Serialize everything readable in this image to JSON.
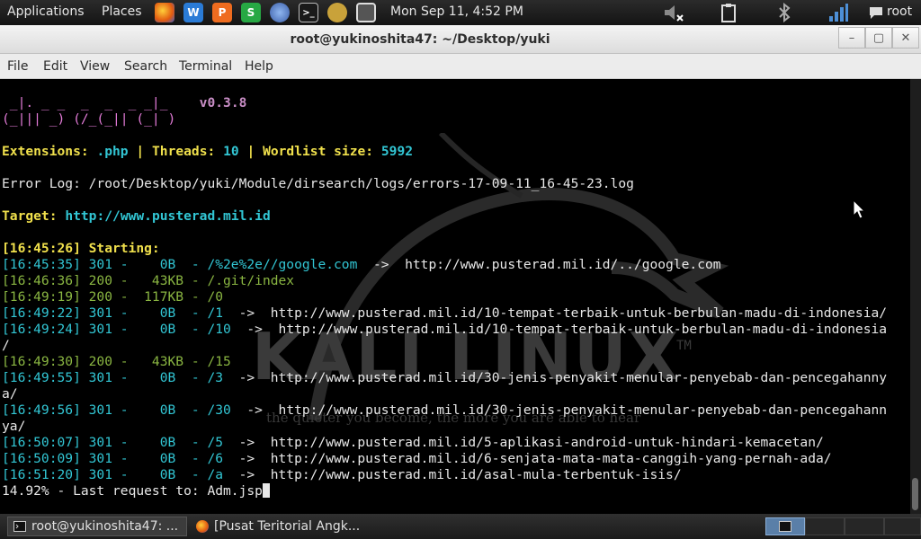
{
  "panel": {
    "applications": "Applications",
    "places": "Places",
    "clock": "Mon Sep 11,  4:52 PM",
    "user": "root",
    "launchers": [
      "firefox-icon",
      "writer-icon",
      "impress-icon",
      "calc-icon",
      "network-icon",
      "terminal-icon",
      "burp-icon",
      "screenshot-icon"
    ],
    "tray": [
      "volume-muted-icon",
      "clipboard-icon",
      "bluetooth-icon",
      "signal-icon",
      "chat-icon"
    ]
  },
  "window": {
    "title": "root@yukinoshita47: ~/Desktop/yuki",
    "controls": {
      "minimize": "–",
      "maximize": "▢",
      "close": "✕"
    }
  },
  "menu": [
    "File",
    "Edit",
    "View",
    "Search",
    "Terminal",
    "Help"
  ],
  "terminal": {
    "banner1": " _|. _ _  _  _  _ _|_",
    "banner2": "(_||| _) (/_(_|| (_| )",
    "version": "v0.3.8",
    "ext_label": "Extensions:",
    "ext_value": ".php",
    "threads_label": "Threads:",
    "threads_value": "10",
    "wordlist_label": "Wordlist size:",
    "wordlist_value": "5992",
    "sep": "|",
    "error_log": "Error Log: /root/Desktop/yuki/Module/dirsearch/logs/errors-17-09-11_16-45-23.log",
    "target_label": "Target:",
    "target_value": "http://www.pusterad.mil.id",
    "starting": "[16:45:26] Starting:",
    "rows": [
      {
        "meta": "[16:45:35] 301 -    0B  - /%2e%2e//google.com",
        "arrow": "  ->  ",
        "url": "http://www.pusterad.mil.id/../google.com",
        "color": "c"
      },
      {
        "meta": "[16:46:36] 200 -   43KB - /.git/index",
        "arrow": "",
        "url": "",
        "color": "g"
      },
      {
        "meta": "[16:49:19] 200 -  117KB - /0",
        "arrow": "",
        "url": "",
        "color": "g"
      },
      {
        "meta": "[16:49:22] 301 -    0B  - /1",
        "arrow": "  ->  ",
        "url": "http://www.pusterad.mil.id/10-tempat-terbaik-untuk-berbulan-madu-di-indonesia/",
        "color": "c"
      },
      {
        "meta": "[16:49:24] 301 -    0B  - /10",
        "arrow": "  ->  ",
        "url": "http://www.pusterad.mil.id/10-tempat-terbaik-untuk-berbulan-madu-di-indonesia",
        "color": "c"
      },
      {
        "meta": "/",
        "arrow": "",
        "url": "",
        "color": "w"
      },
      {
        "meta": "[16:49:30] 200 -   43KB - /15",
        "arrow": "",
        "url": "",
        "color": "g"
      },
      {
        "meta": "[16:49:55] 301 -    0B  - /3",
        "arrow": "  ->  ",
        "url": "http://www.pusterad.mil.id/30-jenis-penyakit-menular-penyebab-dan-pencegahanny",
        "color": "c"
      },
      {
        "meta": "a/",
        "arrow": "",
        "url": "",
        "color": "w"
      },
      {
        "meta": "[16:49:56] 301 -    0B  - /30",
        "arrow": "  ->  ",
        "url": "http://www.pusterad.mil.id/30-jenis-penyakit-menular-penyebab-dan-pencegahann",
        "color": "c"
      },
      {
        "meta": "ya/",
        "arrow": "",
        "url": "",
        "color": "w"
      },
      {
        "meta": "[16:50:07] 301 -    0B  - /5",
        "arrow": "  ->  ",
        "url": "http://www.pusterad.mil.id/5-aplikasi-android-untuk-hindari-kemacetan/",
        "color": "c"
      },
      {
        "meta": "[16:50:09] 301 -    0B  - /6",
        "arrow": "  ->  ",
        "url": "http://www.pusterad.mil.id/6-senjata-mata-mata-canggih-yang-pernah-ada/",
        "color": "c"
      },
      {
        "meta": "[16:51:20] 301 -    0B  - /a",
        "arrow": "  ->  ",
        "url": "http://www.pusterad.mil.id/asal-mula-terbentuk-isis/",
        "color": "c"
      }
    ],
    "progress": "14.92% - Last request to: Adm.jsp",
    "watermark": "KALI LINUX",
    "watermark_tm": "TM",
    "tagline": "the quieter you become, the more you are able to hear"
  },
  "taskbar": {
    "task1": "root@yukinoshita47: ...",
    "task2": "[Pusat Teritorial Angk..."
  }
}
